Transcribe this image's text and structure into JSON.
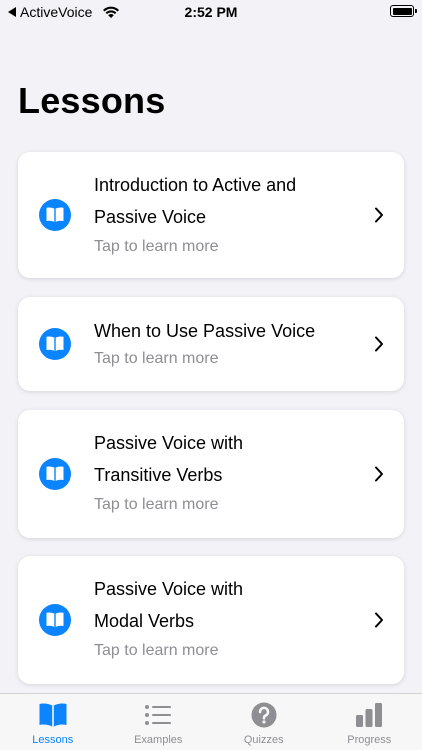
{
  "status_bar": {
    "back_label": "ActiveVoice",
    "time": "2:52 PM"
  },
  "page": {
    "title": "Lessons"
  },
  "lessons": [
    {
      "title_line1": "Introduction to Active and",
      "title_line2": "Passive Voice",
      "subtitle": "Tap to learn more"
    },
    {
      "title_line1": "When to Use Passive Voice",
      "title_line2": "",
      "subtitle": "Tap to learn more"
    },
    {
      "title_line1": "Passive Voice with",
      "title_line2": "Transitive Verbs",
      "subtitle": "Tap to learn more"
    },
    {
      "title_line1": "Passive Voice with",
      "title_line2": "Modal Verbs",
      "subtitle": "Tap to learn more"
    }
  ],
  "tab_bar": {
    "tabs": [
      {
        "label": "Lessons",
        "icon": "book-icon",
        "active": true
      },
      {
        "label": "Examples",
        "icon": "list-icon",
        "active": false
      },
      {
        "label": "Quizzes",
        "icon": "question-icon",
        "active": false
      },
      {
        "label": "Progress",
        "icon": "bar-chart-icon",
        "active": false
      }
    ]
  },
  "colors": {
    "accent": "#0A84FF",
    "background": "#F2F2F7",
    "card": "#FFFFFF",
    "secondary_text": "#8E8E93",
    "inactive_tab": "#8E8E93"
  }
}
